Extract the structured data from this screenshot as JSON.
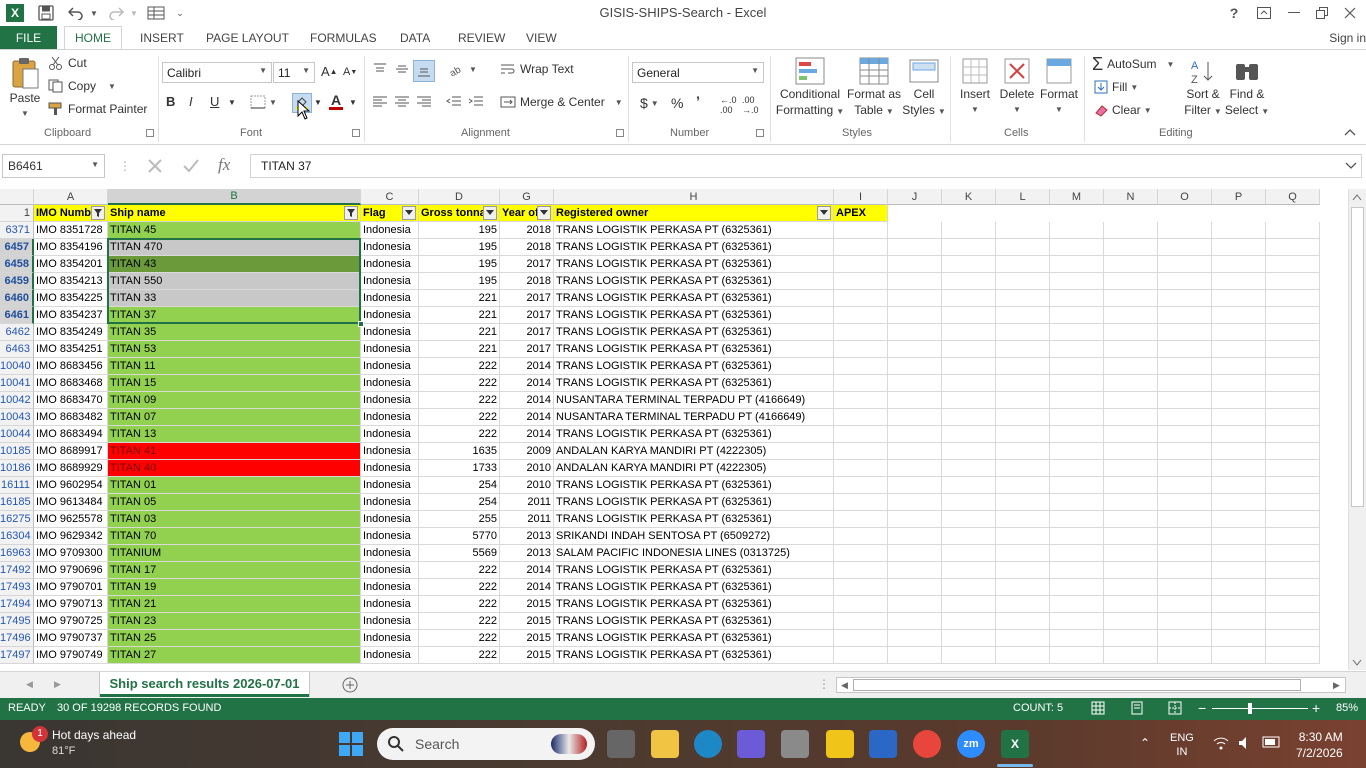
{
  "window": {
    "title": "GISIS-SHIPS-Search - Excel"
  },
  "tabs": {
    "file": "FILE",
    "home": "HOME",
    "insert": "INSERT",
    "page_layout": "PAGE LAYOUT",
    "formulas": "FORMULAS",
    "data": "DATA",
    "review": "REVIEW",
    "view": "VIEW",
    "signin": "Sign in"
  },
  "ribbon": {
    "clipboard": {
      "paste": "Paste",
      "cut": "Cut",
      "copy": "Copy",
      "format_painter": "Format Painter",
      "label": "Clipboard"
    },
    "font": {
      "name": "Calibri",
      "size": "11",
      "bold": "B",
      "italic": "I",
      "underline": "U",
      "label": "Font"
    },
    "alignment": {
      "wrap": "Wrap Text",
      "merge": "Merge & Center",
      "label": "Alignment"
    },
    "number": {
      "format": "General",
      "currency": "$",
      "percent": "%",
      "comma": "’",
      "label": "Number"
    },
    "styles": {
      "conditional1": "Conditional",
      "conditional2": "Formatting",
      "format_table1": "Format as",
      "format_table2": "Table",
      "cell_styles1": "Cell",
      "cell_styles2": "Styles",
      "label": "Styles"
    },
    "cells": {
      "insert": "Insert",
      "delete": "Delete",
      "format": "Format",
      "label": "Cells"
    },
    "editing": {
      "autosum": "AutoSum",
      "fill": "Fill",
      "clear": "Clear",
      "sort1": "Sort &",
      "sort2": "Filter",
      "find1": "Find &",
      "find2": "Select",
      "label": "Editing"
    }
  },
  "formula_bar": {
    "name_box": "B6461",
    "content": "TITAN 37",
    "fx": "fx"
  },
  "columns": [
    {
      "letter": "A"
    },
    {
      "letter": "B"
    },
    {
      "letter": "C"
    },
    {
      "letter": "D"
    },
    {
      "letter": "G"
    },
    {
      "letter": "H"
    },
    {
      "letter": "I"
    },
    {
      "letter": "J"
    },
    {
      "letter": "K"
    },
    {
      "letter": "L"
    },
    {
      "letter": "M"
    },
    {
      "letter": "N"
    },
    {
      "letter": "O"
    },
    {
      "letter": "P"
    },
    {
      "letter": "Q"
    }
  ],
  "header_row": {
    "row": "1",
    "imo": "IMO Numb",
    "ship": "Ship name",
    "flag": "Flag",
    "gross": "Gross tonnag",
    "year": "Year of",
    "owner": "Registered owner",
    "apex": "APEX"
  },
  "rows": [
    {
      "row": "6371",
      "imo": "IMO 8351728",
      "ship": "TITAN 45",
      "flag": "Indonesia",
      "gross": "195",
      "year": "2018",
      "owner": "TRANS LOGISTIK PERKASA PT (6325361)"
    },
    {
      "row": "6457",
      "imo": "IMO 8354196",
      "ship": "TITAN 470",
      "flag": "Indonesia",
      "gross": "195",
      "year": "2018",
      "owner": "TRANS LOGISTIK PERKASA PT (6325361)"
    },
    {
      "row": "6458",
      "imo": "IMO 8354201",
      "ship": "TITAN 43",
      "flag": "Indonesia",
      "gross": "195",
      "year": "2017",
      "owner": "TRANS LOGISTIK PERKASA PT (6325361)"
    },
    {
      "row": "6459",
      "imo": "IMO 8354213",
      "ship": "TITAN 550",
      "flag": "Indonesia",
      "gross": "195",
      "year": "2018",
      "owner": "TRANS LOGISTIK PERKASA PT (6325361)"
    },
    {
      "row": "6460",
      "imo": "IMO 8354225",
      "ship": "TITAN 33",
      "flag": "Indonesia",
      "gross": "221",
      "year": "2017",
      "owner": "TRANS LOGISTIK PERKASA PT (6325361)"
    },
    {
      "row": "6461",
      "imo": "IMO 8354237",
      "ship": "TITAN 37",
      "flag": "Indonesia",
      "gross": "221",
      "year": "2017",
      "owner": "TRANS LOGISTIK PERKASA PT (6325361)"
    },
    {
      "row": "6462",
      "imo": "IMO 8354249",
      "ship": "TITAN 35",
      "flag": "Indonesia",
      "gross": "221",
      "year": "2017",
      "owner": "TRANS LOGISTIK PERKASA PT (6325361)"
    },
    {
      "row": "6463",
      "imo": "IMO 8354251",
      "ship": "TITAN 53",
      "flag": "Indonesia",
      "gross": "221",
      "year": "2017",
      "owner": "TRANS LOGISTIK PERKASA PT (6325361)"
    },
    {
      "row": "10040",
      "imo": "IMO 8683456",
      "ship": "TITAN 11",
      "flag": "Indonesia",
      "gross": "222",
      "year": "2014",
      "owner": "TRANS LOGISTIK PERKASA PT (6325361)"
    },
    {
      "row": "10041",
      "imo": "IMO 8683468",
      "ship": "TITAN 15",
      "flag": "Indonesia",
      "gross": "222",
      "year": "2014",
      "owner": "TRANS LOGISTIK PERKASA PT (6325361)"
    },
    {
      "row": "10042",
      "imo": "IMO 8683470",
      "ship": "TITAN 09",
      "flag": "Indonesia",
      "gross": "222",
      "year": "2014",
      "owner": "NUSANTARA TERMINAL TERPADU PT (4166649)"
    },
    {
      "row": "10043",
      "imo": "IMO 8683482",
      "ship": "TITAN 07",
      "flag": "Indonesia",
      "gross": "222",
      "year": "2014",
      "owner": "NUSANTARA TERMINAL TERPADU PT (4166649)"
    },
    {
      "row": "10044",
      "imo": "IMO 8683494",
      "ship": "TITAN 13",
      "flag": "Indonesia",
      "gross": "222",
      "year": "2014",
      "owner": "TRANS LOGISTIK PERKASA PT (6325361)"
    },
    {
      "row": "10185",
      "imo": "IMO 8689917",
      "ship": "TITAN 41",
      "flag": "Indonesia",
      "gross": "1635",
      "year": "2009",
      "owner": "ANDALAN KARYA MANDIRI PT (4222305)"
    },
    {
      "row": "10186",
      "imo": "IMO 8689929",
      "ship": "TITAN 40",
      "flag": "Indonesia",
      "gross": "1733",
      "year": "2010",
      "owner": "ANDALAN KARYA MANDIRI PT (4222305)"
    },
    {
      "row": "16111",
      "imo": "IMO 9602954",
      "ship": "TITAN 01",
      "flag": "Indonesia",
      "gross": "254",
      "year": "2010",
      "owner": "TRANS LOGISTIK PERKASA PT (6325361)"
    },
    {
      "row": "16185",
      "imo": "IMO 9613484",
      "ship": "TITAN 05",
      "flag": "Indonesia",
      "gross": "254",
      "year": "2011",
      "owner": "TRANS LOGISTIK PERKASA PT (6325361)"
    },
    {
      "row": "16275",
      "imo": "IMO 9625578",
      "ship": "TITAN 03",
      "flag": "Indonesia",
      "gross": "255",
      "year": "2011",
      "owner": "TRANS LOGISTIK PERKASA PT (6325361)"
    },
    {
      "row": "16304",
      "imo": "IMO 9629342",
      "ship": "TITAN 70",
      "flag": "Indonesia",
      "gross": "5770",
      "year": "2013",
      "owner": "SRIKANDI INDAH SENTOSA PT (6509272)"
    },
    {
      "row": "16963",
      "imo": "IMO 9709300",
      "ship": "TITANIUM",
      "flag": "Indonesia",
      "gross": "5569",
      "year": "2013",
      "owner": "SALAM PACIFIC INDONESIA LINES (0313725)"
    },
    {
      "row": "17492",
      "imo": "IMO 9790696",
      "ship": "TITAN 17",
      "flag": "Indonesia",
      "gross": "222",
      "year": "2014",
      "owner": "TRANS LOGISTIK PERKASA PT (6325361)"
    },
    {
      "row": "17493",
      "imo": "IMO 9790701",
      "ship": "TITAN 19",
      "flag": "Indonesia",
      "gross": "222",
      "year": "2014",
      "owner": "TRANS LOGISTIK PERKASA PT (6325361)"
    },
    {
      "row": "17494",
      "imo": "IMO 9790713",
      "ship": "TITAN 21",
      "flag": "Indonesia",
      "gross": "222",
      "year": "2015",
      "owner": "TRANS LOGISTIK PERKASA PT (6325361)"
    },
    {
      "row": "17495",
      "imo": "IMO 9790725",
      "ship": "TITAN 23",
      "flag": "Indonesia",
      "gross": "222",
      "year": "2015",
      "owner": "TRANS LOGISTIK PERKASA PT (6325361)"
    },
    {
      "row": "17496",
      "imo": "IMO 9790737",
      "ship": "TITAN 25",
      "flag": "Indonesia",
      "gross": "222",
      "year": "2015",
      "owner": "TRANS LOGISTIK PERKASA PT (6325361)"
    },
    {
      "row": "17497",
      "imo": "IMO 9790749",
      "ship": "TITAN 27",
      "flag": "Indonesia",
      "gross": "222",
      "year": "2015",
      "owner": "TRANS LOGISTIK PERKASA PT (6325361)"
    }
  ],
  "colors": {
    "green": "#92d050",
    "red": "#ff0000",
    "selection_gray": "#c8c8c8",
    "dark_selected": "#6a9a3a",
    "header_yellow": "#ffff00",
    "excel_green": "#217346"
  },
  "sheet": {
    "tab_name": "Ship search results 2026-07-01"
  },
  "status": {
    "ready": "READY",
    "records": "30 OF 19298 RECORDS FOUND",
    "count": "COUNT: 5",
    "zoom": "85%"
  },
  "taskbar": {
    "weather_title": "Hot days ahead",
    "temp": "81°F",
    "badge": "1",
    "search": "Search",
    "lang1": "ENG",
    "lang2": "IN",
    "time": "8:30 AM",
    "date": "7/2/2026",
    "zoom_app": "zm"
  }
}
